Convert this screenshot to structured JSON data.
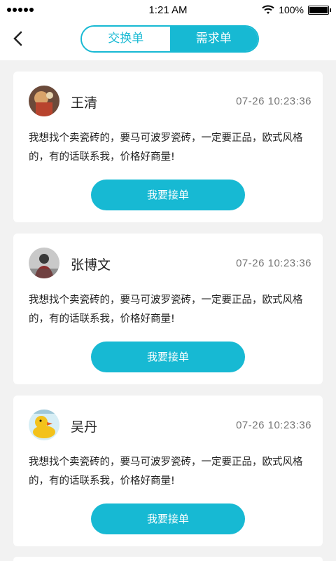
{
  "status_bar": {
    "time": "1:21 AM",
    "battery": "100%"
  },
  "nav": {
    "tabs": [
      {
        "label": "交换单",
        "active": false
      },
      {
        "label": "需求单",
        "active": true
      }
    ]
  },
  "orders": [
    {
      "name": "王清",
      "time": "07-26   10:23:36",
      "content": "我想找个卖瓷砖的，要马可波罗瓷砖，一定要正品，欧式风格的，有的话联系我，价格好商量!",
      "button": "我要接单"
    },
    {
      "name": "张博文",
      "time": "07-26   10:23:36",
      "content": "我想找个卖瓷砖的，要马可波罗瓷砖，一定要正品，欧式风格的，有的话联系我，价格好商量!",
      "button": "我要接单"
    },
    {
      "name": "吴丹",
      "time": "07-26   10:23:36",
      "content": "我想找个卖瓷砖的，要马可波罗瓷砖，一定要正品，欧式风格的，有的话联系我，价格好商量!",
      "button": "我要接单"
    }
  ],
  "colors": {
    "accent": "#17b9d3",
    "background": "#f2f2f2"
  }
}
